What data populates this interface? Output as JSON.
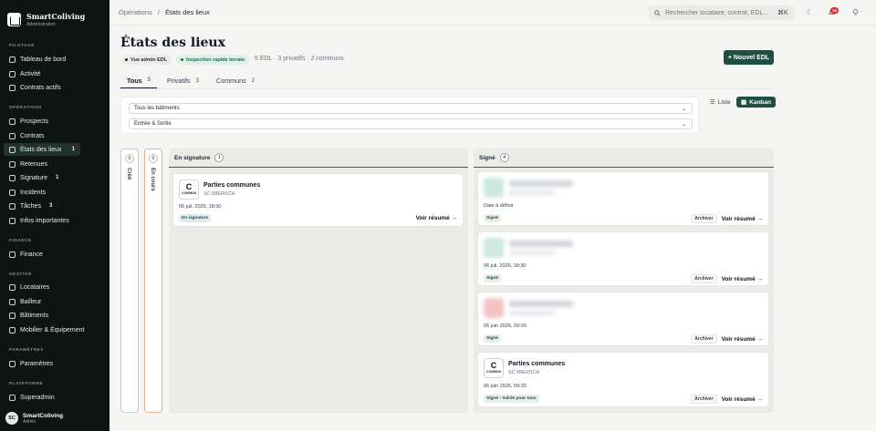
{
  "brand": {
    "name": "SmartColiving",
    "subtitle": "Administration"
  },
  "sidebar": {
    "sections": {
      "pilotage": "PILOTAGE",
      "operations": "OPÉRATIONS",
      "finance": "FINANCE",
      "gestion": "GESTION",
      "parametres": "PARAMÈTRES",
      "plateforme": "PLATEFORME"
    },
    "items": [
      {
        "label": "Tableau de bord",
        "icon": "dashboard-icon"
      },
      {
        "label": "Activité",
        "icon": "activity-icon"
      },
      {
        "label": "Contrats actifs",
        "icon": "contract-icon"
      },
      {
        "label": "Prospects",
        "icon": "prospects-icon"
      },
      {
        "label": "Contrats",
        "icon": "contracts-icon"
      },
      {
        "label": "États des lieux",
        "icon": "checklist-icon",
        "count": "1"
      },
      {
        "label": "Retenues",
        "icon": "retention-icon"
      },
      {
        "label": "Signature",
        "icon": "signature-icon",
        "count": "1"
      },
      {
        "label": "Incidents",
        "icon": "incident-icon"
      },
      {
        "label": "Tâches",
        "icon": "tasks-icon",
        "count": "3"
      },
      {
        "label": "Infos importantes",
        "icon": "info-icon"
      },
      {
        "label": "Finance",
        "icon": "finance-icon"
      },
      {
        "label": "Locataires",
        "icon": "tenants-icon"
      },
      {
        "label": "Bailleur",
        "icon": "landlord-icon"
      },
      {
        "label": "Bâtiments",
        "icon": "buildings-icon"
      },
      {
        "label": "Mobilier & Équipement",
        "icon": "furniture-icon"
      },
      {
        "label": "Paramètres",
        "icon": "gear-icon"
      },
      {
        "label": "Superadmin",
        "icon": "shield-icon"
      }
    ],
    "user": {
      "initials": "SC",
      "name": "SmartColiving",
      "role": "Admin"
    }
  },
  "topbar": {
    "breadcrumb": {
      "parent": "Opérations",
      "sep": "/",
      "current": "États des lieux"
    },
    "search_placeholder": "Rechercher locataire, contrat, EDL...",
    "shortcut": "⌘K",
    "notif_count": "16"
  },
  "header": {
    "title": "États des lieux",
    "pill_admin": "Vue admin EDL",
    "pill_terrain": "Inspection rapide terrain",
    "meta": "5 EDL · 3 privatifs · 2 communs",
    "new_button": "+ Nouvel EDL"
  },
  "tabs": [
    {
      "label": "Tous",
      "count": "5"
    },
    {
      "label": "Privatifs",
      "count": "3"
    },
    {
      "label": "Communs",
      "count": "2"
    }
  ],
  "filters": {
    "building": "Tous les bâtiments",
    "type": "Entrée & Sortie"
  },
  "views": {
    "list": "Liste",
    "kanban": "Kanban"
  },
  "columns": {
    "cree": {
      "label": "Créé",
      "count": "0"
    },
    "encours": {
      "label": "En cours",
      "count": "0"
    },
    "ensignature": {
      "label": "En signature",
      "count": "1"
    },
    "signe": {
      "label": "Signé",
      "count": "4"
    }
  },
  "cards": {
    "sig1": {
      "icon_letter": "C",
      "icon_sub": "COMMUN",
      "title": "Parties communes",
      "subtitle": "SC MIERSCH",
      "date": "06 juil. 2026, 18:30",
      "tag": "En signature",
      "action": "Voir résumé →"
    },
    "s1": {
      "date": "Date à définir",
      "tag": "Signé",
      "archive": "Archiver",
      "action": "Voir résumé →"
    },
    "s2": {
      "date": "06 juil. 2026, 18:30",
      "tag": "Signé",
      "archive": "Archiver",
      "action": "Voir résumé →"
    },
    "s3": {
      "date": "06 juin 2026, 09:00",
      "tag": "Signé",
      "archive": "Archiver",
      "action": "Voir résumé →"
    },
    "s4": {
      "icon_letter": "C",
      "icon_sub": "COMMUN",
      "title": "Parties communes",
      "subtitle": "SC MIERSCH",
      "date": "06 juin 2026, 09:30",
      "tag": "Signé - Validé pour tous",
      "archive": "Archiver",
      "action": "Voir résumé →"
    }
  },
  "colors": {
    "accent": "#1d4f44",
    "sidebar": "#0f1412",
    "danger": "#dc2626"
  }
}
